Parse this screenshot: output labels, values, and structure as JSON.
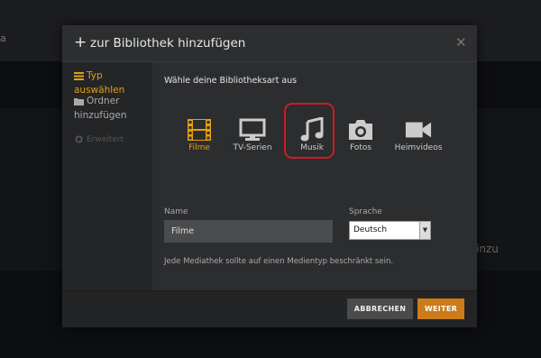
{
  "background": {
    "left_text": "a",
    "right_text": "inzu"
  },
  "modal": {
    "title": "zur Bibliothek hinzufügen",
    "close_glyph": "✕",
    "plus_glyph": "+"
  },
  "sidebar": {
    "items": [
      {
        "label": "Typ auswählen",
        "icon": "library-icon",
        "active": true
      },
      {
        "label": "Ordner hinzufügen",
        "icon": "folder-icon",
        "active": false
      },
      {
        "label": "Erweitert",
        "icon": "gear-icon",
        "active": false
      }
    ]
  },
  "main": {
    "heading": "Wähle deine Bibliotheksart aus",
    "types": [
      {
        "label": "Filme",
        "icon": "film-icon",
        "selected": true
      },
      {
        "label": "TV-Serien",
        "icon": "tv-icon",
        "selected": false
      },
      {
        "label": "Musik",
        "icon": "music-icon",
        "selected": false
      },
      {
        "label": "Fotos",
        "icon": "camera-icon",
        "selected": false
      },
      {
        "label": "Heimvideos",
        "icon": "video-camera-icon",
        "selected": false
      }
    ],
    "name_label": "Name",
    "name_value": "Filme",
    "language_label": "Sprache",
    "language_value": "Deutsch",
    "hint": "Jede Mediathek sollte auf einen Medientyp beschränkt sein."
  },
  "footer": {
    "cancel_label": "ABBRECHEN",
    "next_label": "WEITER"
  },
  "colors": {
    "accent": "#e5a00d",
    "next_button": "#cc7b19",
    "highlight": "#d01c23"
  }
}
